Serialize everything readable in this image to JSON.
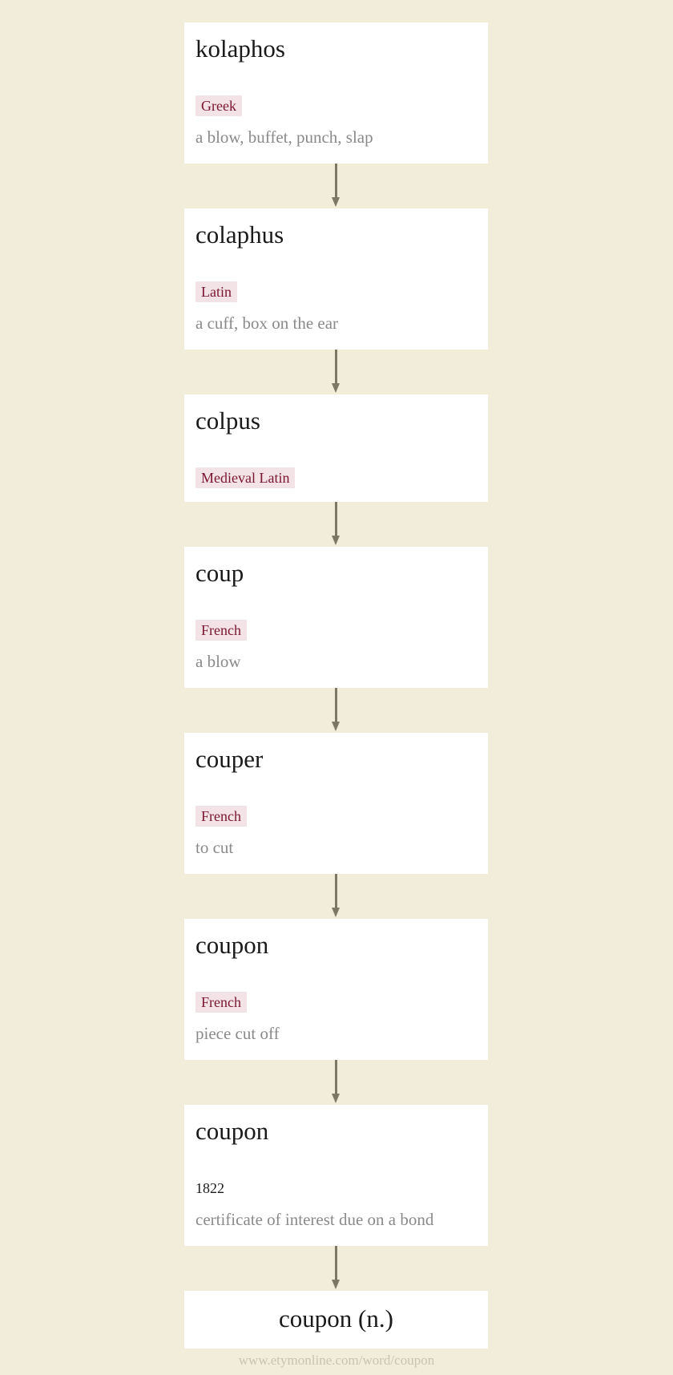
{
  "diagram": {
    "type": "etymology-chain",
    "steps": [
      {
        "word": "kolaphos",
        "language": "Greek",
        "gloss": "a blow, buffet, punch, slap"
      },
      {
        "word": "colaphus",
        "language": "Latin",
        "gloss": "a cuff, box on the ear"
      },
      {
        "word": "colpus",
        "language": "Medieval Latin",
        "gloss": ""
      },
      {
        "word": "coup",
        "language": "French",
        "gloss": "a blow"
      },
      {
        "word": "couper",
        "language": "French",
        "gloss": "to cut"
      },
      {
        "word": "coupon",
        "language": "French",
        "gloss": "piece cut off"
      },
      {
        "word": "coupon",
        "date": "1822",
        "gloss": "certificate of interest due on a bond"
      }
    ],
    "result": {
      "word": "coupon (n.)"
    },
    "arrow_icon": "arrow-down-icon"
  },
  "footer": {
    "source_url_text": "www.etymonline.com/word/coupon"
  },
  "colors": {
    "background": "#f2ecdb",
    "card": "#ffffff",
    "tag_background": "#f3e2e6",
    "tag_text": "#7a1532",
    "gloss_text": "#8a8a8a",
    "arrow": "#7d7766",
    "footer_text": "#c9c3b1"
  }
}
